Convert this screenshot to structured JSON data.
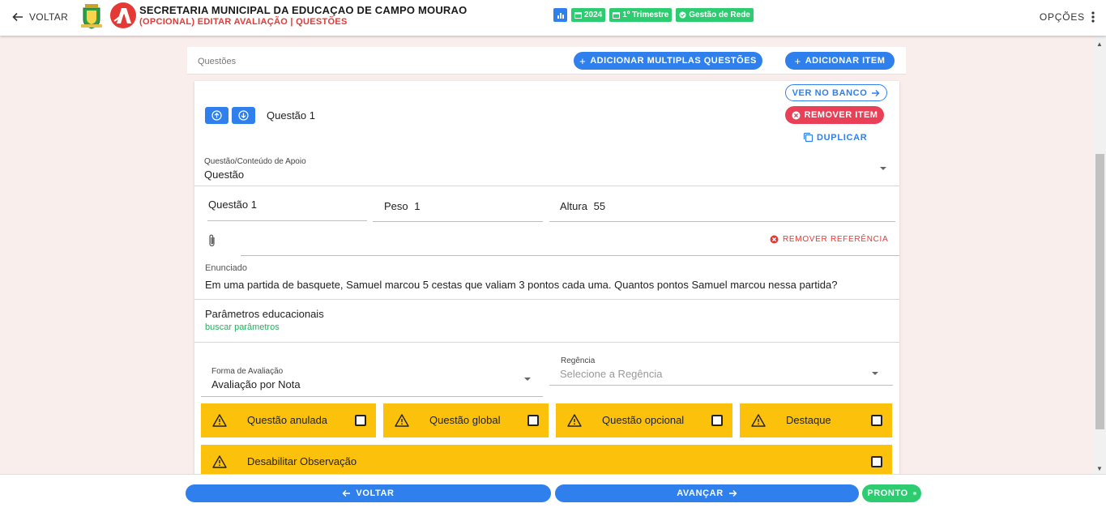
{
  "topbar": {
    "back_label": "VOLTAR",
    "title": "SECRETARIA MUNICIPAL DA EDUCAÇAO DE CAMPO MOURAO",
    "subtitle": "(OPCIONAL) EDITAR AVALIAÇÃO | QUESTÕES",
    "chips": [
      {
        "icon": "chart-icon",
        "label": ""
      },
      {
        "icon": "calendar-icon",
        "label": "2024"
      },
      {
        "icon": "calendar-icon",
        "label": "1º Trimestre"
      },
      {
        "icon": "check-circle-icon",
        "label": "Gestão de Rede"
      }
    ],
    "options_label": "OPÇÕES"
  },
  "questions_header": {
    "label": "Questões",
    "add_multiple_label": "ADICIONAR MULTIPLAS QUESTÕES",
    "add_item_label": "ADICIONAR ITEM"
  },
  "question": {
    "name": "Questão 1",
    "see_bank_label": "VER NO BANCO",
    "remove_item_label": "REMOVER ITEM",
    "duplicate_label": "DUPLICAR",
    "support_label": "Questão/Conteúdo de Apoio",
    "support_value": "Questão",
    "name_field": "Questão 1",
    "weight_label": "Peso",
    "weight_value": "1",
    "height_label": "Altura",
    "height_value": "55",
    "remove_reference_label": "REMOVER REFERÊNCIA",
    "statement_label": "Enunciado",
    "statement_text": "Em uma partida de basquete, Samuel marcou 5 cestas que valiam 3 pontos cada uma. Quantos pontos Samuel marcou nessa partida?",
    "params_title": "Parâmetros educacionais",
    "params_link": "buscar parâmetros",
    "evaluation_label": "Forma de Avaliação",
    "evaluation_value": "Avaliação por Nota",
    "regencia_label": "Regência",
    "regencia_placeholder": "Selecione a Regência",
    "flags": [
      {
        "label": "Questão anulada",
        "checked": false
      },
      {
        "label": "Questão global",
        "checked": false
      },
      {
        "label": "Questão opcional",
        "checked": false
      },
      {
        "label": "Destaque",
        "checked": false
      },
      {
        "label": "Desabilitar Observação",
        "checked": false
      }
    ]
  },
  "footer": {
    "back_label": "VOLTAR",
    "next_label": "AVANÇAR",
    "done_label": "PRONTO"
  },
  "colors": {
    "primary": "#2f80ed",
    "success": "#2ecc71",
    "danger": "#e94057",
    "warning": "#fcc10b",
    "page_bg": "#faeeec"
  }
}
